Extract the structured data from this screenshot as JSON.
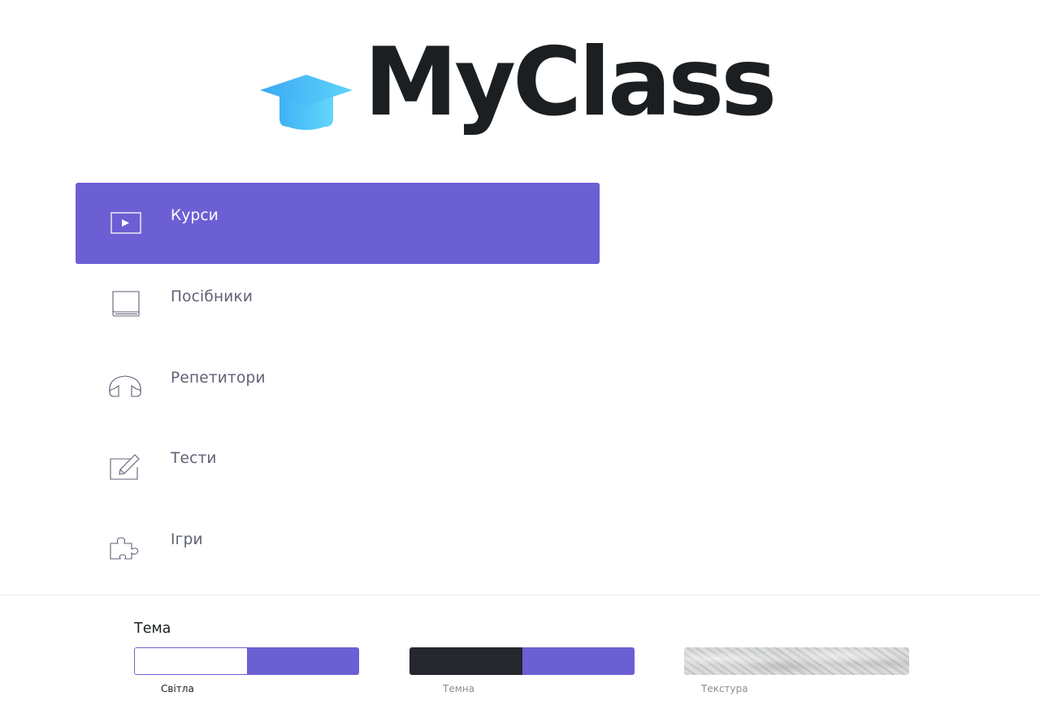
{
  "logo": {
    "text": "MyClass",
    "icon": "graduation-cap-icon",
    "icon_color": "#4fc3f7",
    "text_color": "#1b1f22"
  },
  "menu": {
    "accent_color": "#6c5fd4",
    "active_index": 0,
    "items": [
      {
        "label": "Курси",
        "icon": "video-play-icon"
      },
      {
        "label": "Посібники",
        "icon": "book-icon"
      },
      {
        "label": "Репетитори",
        "icon": "headphones-icon"
      },
      {
        "label": "Тести",
        "icon": "edit-icon"
      },
      {
        "label": "Ігри",
        "icon": "puzzle-icon"
      }
    ]
  },
  "theme": {
    "title": "Тема",
    "selected": "Світла",
    "options": [
      {
        "label": "Світла",
        "colors": [
          "#ffffff",
          "#6c5fd4"
        ]
      },
      {
        "label": "Темна",
        "colors": [
          "#24272e",
          "#6c5fd4"
        ]
      },
      {
        "label": "Текстура",
        "colors": [
          "#cfd0d1"
        ]
      }
    ]
  }
}
